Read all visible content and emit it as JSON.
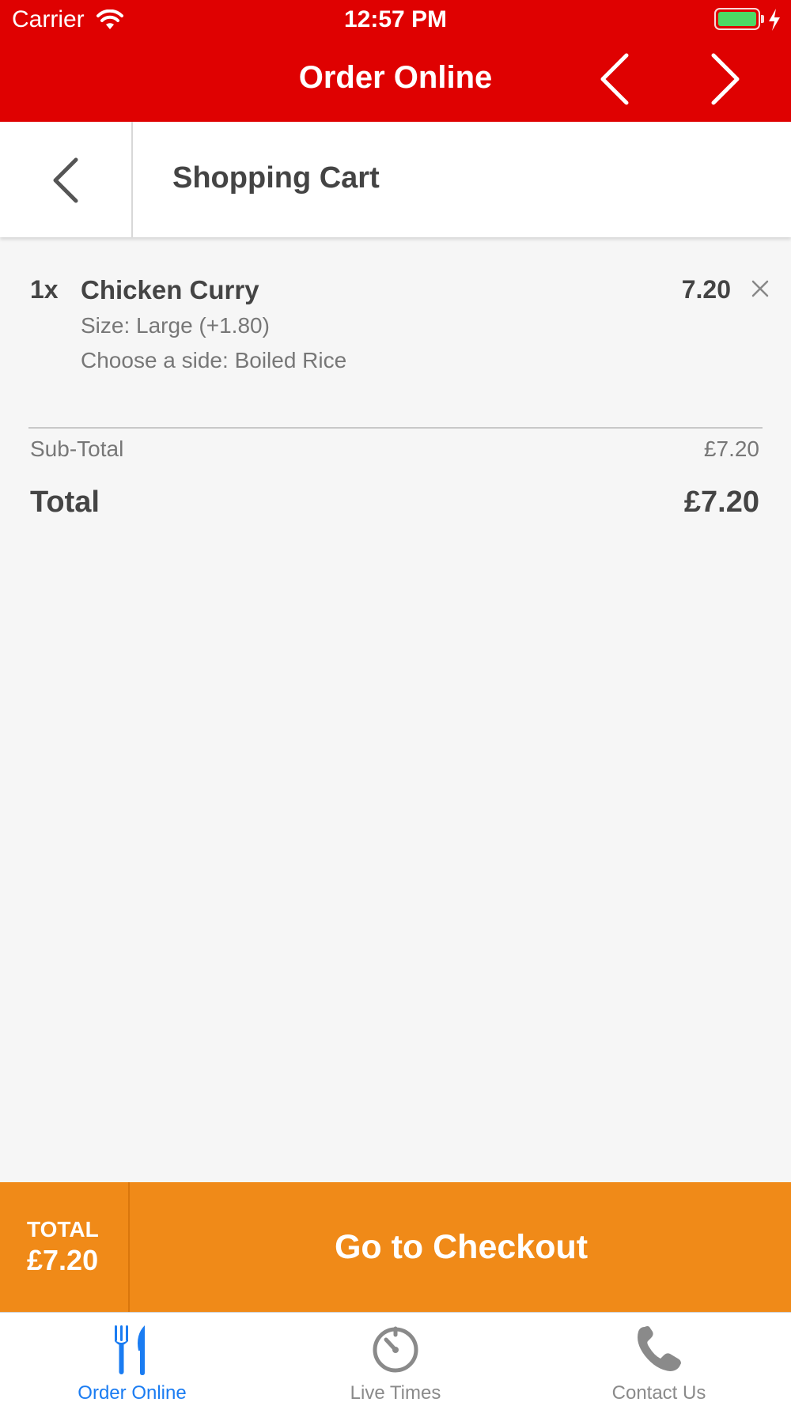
{
  "status_bar": {
    "carrier": "Carrier",
    "time": "12:57 PM"
  },
  "nav": {
    "title": "Order Online",
    "prev_icon": "chevron-left-icon",
    "next_icon": "chevron-right-icon"
  },
  "header": {
    "title": "Shopping Cart",
    "back_icon": "chevron-left-icon"
  },
  "cart": {
    "items": [
      {
        "qty": "1x",
        "name": "Chicken Curry",
        "price": "7.20",
        "options": [
          "Size: Large (+1.80)",
          "Choose a side: Boiled Rice"
        ],
        "remove_icon": "close-icon"
      }
    ],
    "subtotal_label": "Sub-Total",
    "subtotal_value": "£7.20",
    "total_label": "Total",
    "total_value": "£7.20"
  },
  "checkout": {
    "total_label": "TOTAL",
    "total_value": "£7.20",
    "button_label": "Go to Checkout"
  },
  "tabs": [
    {
      "label": "Order Online",
      "icon": "fork-knife-icon",
      "active": true
    },
    {
      "label": "Live Times",
      "icon": "timer-icon",
      "active": false
    },
    {
      "label": "Contact Us",
      "icon": "phone-icon",
      "active": false
    }
  ],
  "colors": {
    "brand_red": "#df0101",
    "checkout_orange": "#f08a18",
    "active_tab": "#1a7cf2",
    "battery_green": "#4cd964"
  }
}
